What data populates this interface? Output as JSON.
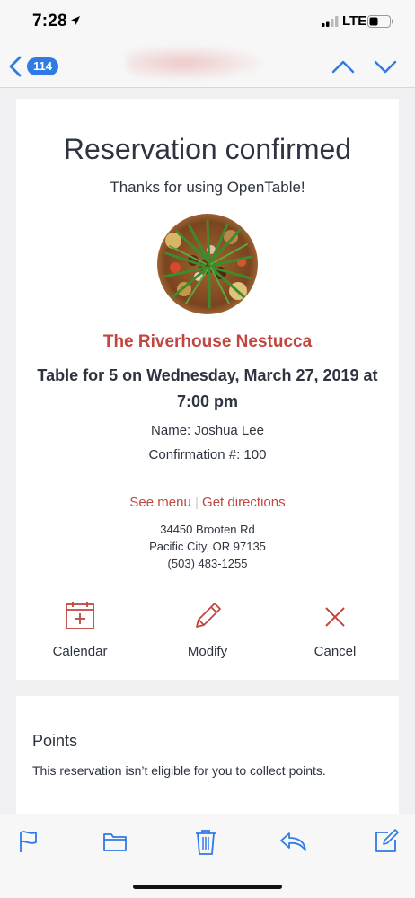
{
  "status_bar": {
    "time": "7:28",
    "carrier": "LTE",
    "icons": [
      "location-arrow-icon",
      "signal-bars-icon",
      "battery-icon"
    ]
  },
  "nav": {
    "back_count": "114",
    "icons": [
      "back-chevron-icon",
      "chevron-up-icon",
      "chevron-down-icon"
    ],
    "accent_color": "#2f7ae5"
  },
  "reservation": {
    "title": "Reservation confirmed",
    "subtitle": "Thanks for using OpenTable!",
    "restaurant_name": "The Riverhouse Nestucca",
    "table_line": "Table for 5 on Wednesday, March 27, 2019 at 7:00 pm",
    "name_line": "Name: Joshua Lee",
    "confirmation_line": "Confirmation #: 100",
    "links": {
      "see_menu": "See menu",
      "separator": "|",
      "get_directions": "Get directions"
    },
    "address": {
      "street": "34450 Brooten Rd",
      "city_line": "Pacific City, OR 97135",
      "phone": "(503) 483-1255"
    },
    "actions": [
      {
        "label": "Calendar",
        "icon": "calendar-icon"
      },
      {
        "label": "Modify",
        "icon": "pencil-icon"
      },
      {
        "label": "Cancel",
        "icon": "close-icon"
      }
    ],
    "brand_color": "#c0463f"
  },
  "points": {
    "title": "Points",
    "text": "This reservation isn’t eligible for you to collect points."
  },
  "toolbar": {
    "icons": [
      "flag-icon",
      "folder-icon",
      "trash-icon",
      "reply-icon",
      "compose-icon"
    ]
  }
}
